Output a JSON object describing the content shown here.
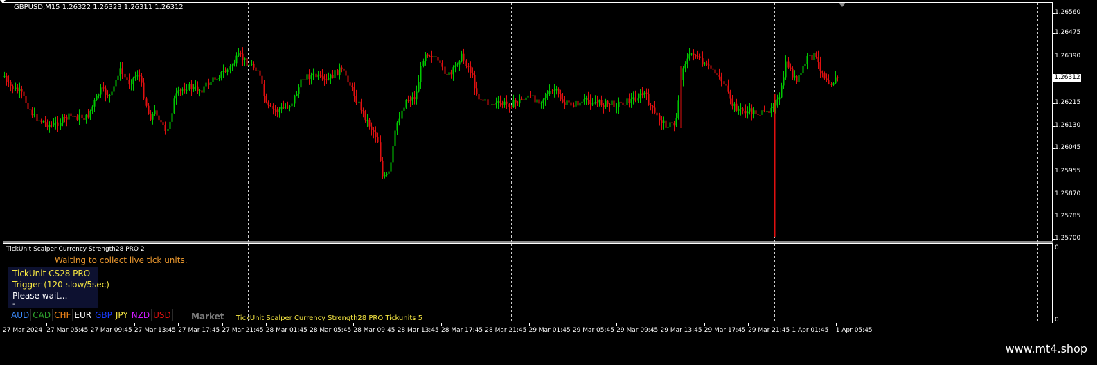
{
  "chart": {
    "symbol_line": "GBPUSD,M15  1.26322 1.26323 1.26311 1.26312",
    "current_price": "1.26312",
    "price_levels": [
      "1.26560",
      "1.26475",
      "1.26390",
      "1.26312",
      "1.26215",
      "1.26130",
      "1.26045",
      "1.25955",
      "1.25870",
      "1.25785",
      "1.25700"
    ],
    "time_labels": [
      "27 Mar 2024",
      "27 Mar 05:45",
      "27 Mar 09:45",
      "27 Mar 13:45",
      "27 Mar 17:45",
      "27 Mar 21:45",
      "28 Mar 01:45",
      "28 Mar 05:45",
      "28 Mar 09:45",
      "28 Mar 13:45",
      "28 Mar 17:45",
      "28 Mar 21:45",
      "29 Mar 01:45",
      "29 Mar 05:45",
      "29 Mar 09:45",
      "29 Mar 13:45",
      "29 Mar 17:45",
      "29 Mar 21:45",
      "1 Apr 01:45",
      "1 Apr 05:45"
    ],
    "bull_color": "#00c800",
    "bear_color": "#e01010"
  },
  "indicator": {
    "title": "TickUnit Scalper Currency Strength28 PRO 2",
    "waiting_message": "Waiting to collect live tick units.",
    "line1": "TickUnit CS28 PRO",
    "line2": "Trigger (120 slow/5sec)",
    "line3": "Please wait...",
    "dash": "-",
    "scale_top": "0",
    "scale_bottom": "0",
    "currencies": [
      {
        "code": "AUD",
        "color": "#3c8cff"
      },
      {
        "code": "CAD",
        "color": "#2ea02e"
      },
      {
        "code": "CHF",
        "color": "#ff8c1a"
      },
      {
        "code": "EUR",
        "color": "#ffffff"
      },
      {
        "code": "GBP",
        "color": "#1a3cff"
      },
      {
        "code": "JPY",
        "color": "#f5e642"
      },
      {
        "code": "NZD",
        "color": "#d01cff"
      },
      {
        "code": "USD",
        "color": "#e01010"
      }
    ],
    "market_label": "Market",
    "bottom_label": "TickUnit Scalper Currency Strength28 PRO  Tickunits 5"
  },
  "footer": {
    "watermark": "www.mt4.shop"
  }
}
